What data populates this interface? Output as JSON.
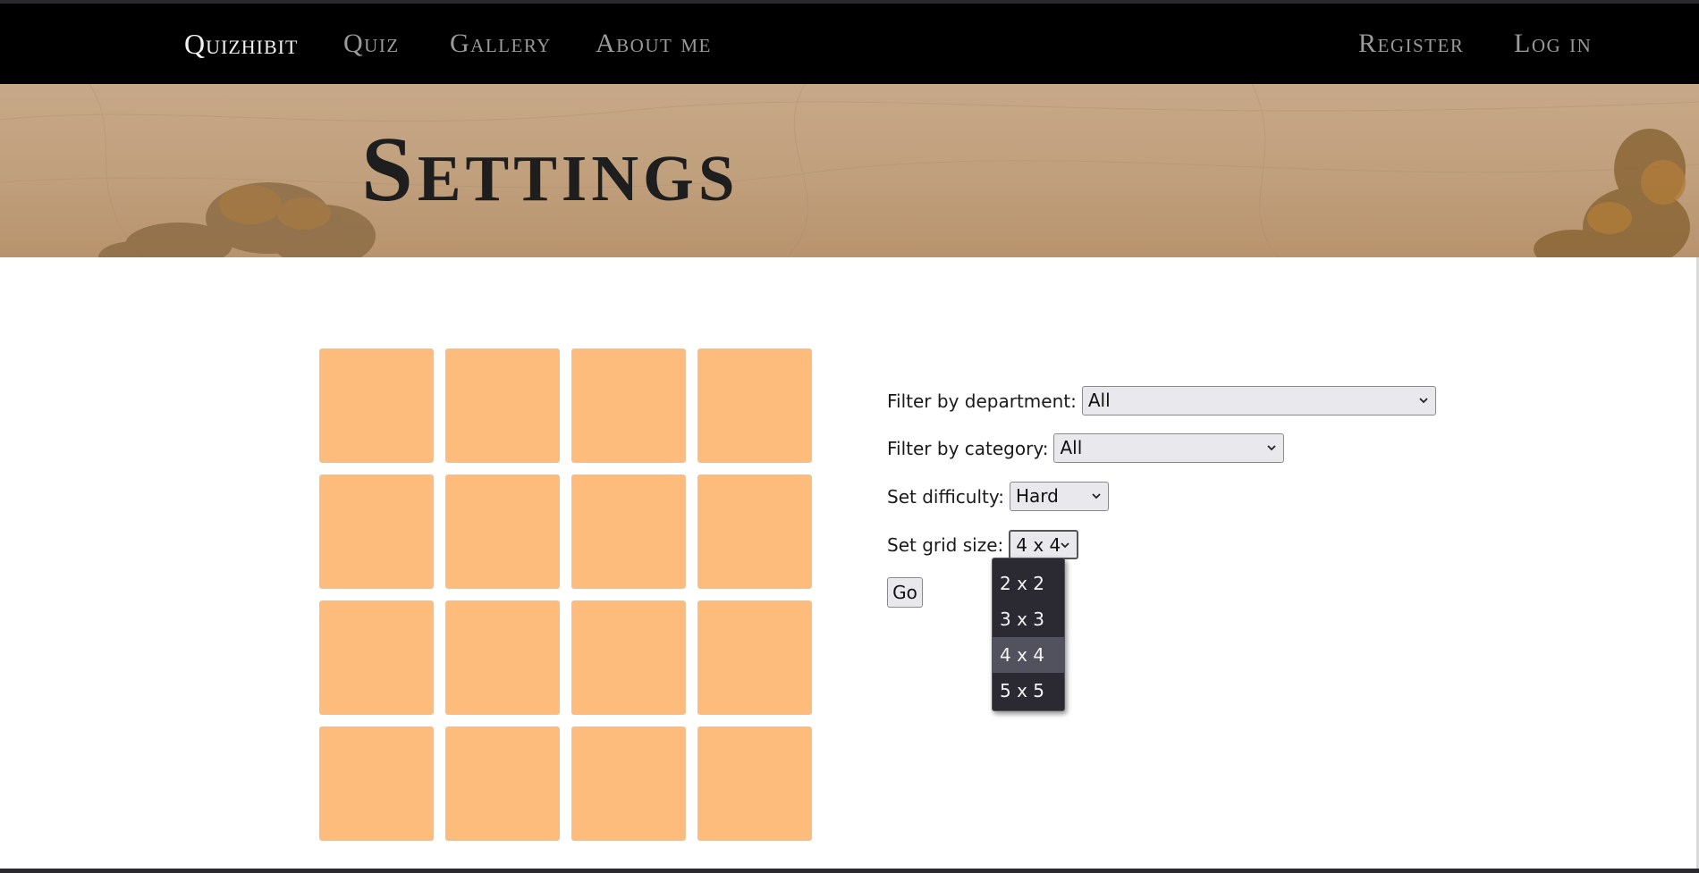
{
  "nav": {
    "brand": "Quizhibit",
    "links": [
      "Quiz",
      "Gallery",
      "About me"
    ],
    "register": "Register",
    "login": "Log in"
  },
  "banner": {
    "title": "Settings"
  },
  "board": {
    "rows": 4,
    "cols": 4,
    "tile_color": "#fdbc7c"
  },
  "form": {
    "department": {
      "label": "Filter by department:",
      "value": "All"
    },
    "category": {
      "label": "Filter by category:",
      "value": "All"
    },
    "difficulty": {
      "label": "Set difficulty:",
      "value": "Hard"
    },
    "grid_size": {
      "label": "Set grid size:",
      "value": "4 x 4",
      "options": [
        "2 x 2",
        "3 x 3",
        "4 x 4",
        "5 x 5"
      ],
      "selected_index": 2
    },
    "go_label": "Go"
  },
  "colors": {
    "navbar": "#000000",
    "dropdown_bg": "#2b2a33",
    "dropdown_selected": "#52515e"
  }
}
